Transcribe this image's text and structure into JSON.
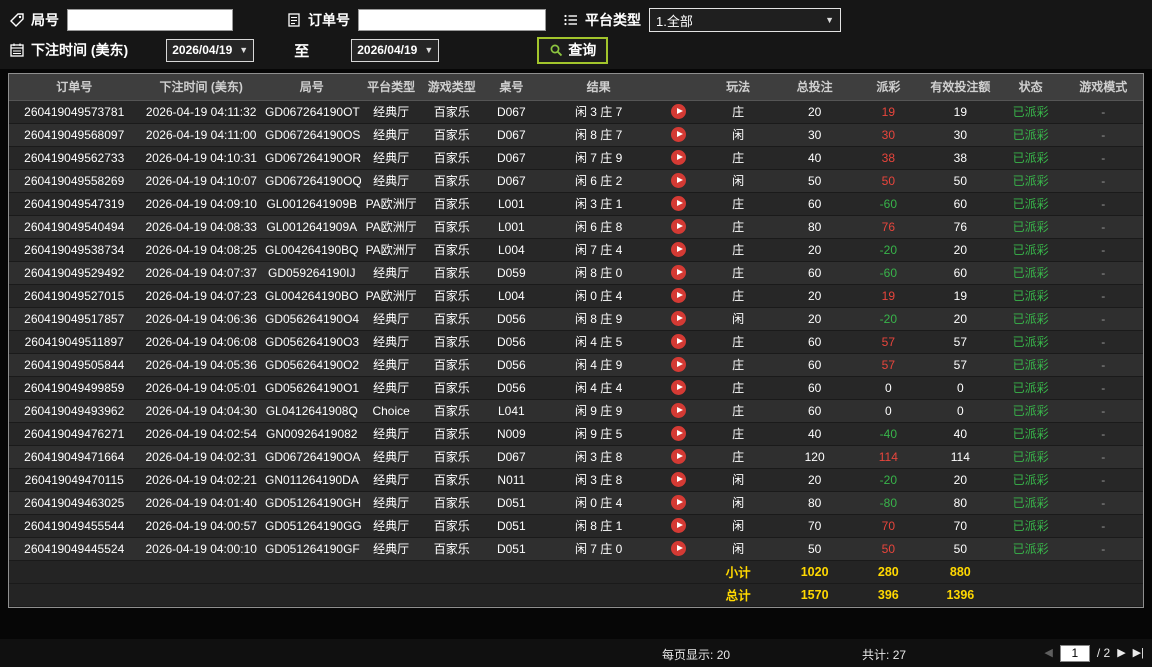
{
  "filters": {
    "round_label": "局号",
    "round_value": "",
    "order_label": "订单号",
    "order_value": "",
    "platform_label": "平台类型",
    "platform_value": "1.全部",
    "bet_time_label": "下注时间 (美东)",
    "date_from": "2026/04/19",
    "to_label": "至",
    "date_to": "2026/04/19",
    "search_label": "查询"
  },
  "icons": {
    "round": "tag-icon",
    "order": "clipboard-icon",
    "platform": "list-icon",
    "bet_time": "calendar-icon",
    "search": "magnifier-icon",
    "video": "play-icon",
    "dropdown_arrow": "▼"
  },
  "table": {
    "headers": [
      "订单号",
      "下注时间 (美东)",
      "局号",
      "平台类型",
      "游戏类型",
      "桌号",
      "结果",
      "",
      "玩法",
      "总投注",
      "派彩",
      "有效投注额",
      "状态",
      "游戏模式"
    ],
    "rows": [
      {
        "order_id": "260419049573781",
        "bet_time": "2026-04-19 04:11:32",
        "round_id": "GD067264190OT",
        "platform": "经典厅",
        "game_type": "百家乐",
        "table_no": "D067",
        "result": "闲 3 庄 7",
        "play": "庄",
        "total_bet": 20,
        "payout": 19,
        "valid_bet": 19,
        "status": "已派彩",
        "mode": "-"
      },
      {
        "order_id": "260419049568097",
        "bet_time": "2026-04-19 04:11:00",
        "round_id": "GD067264190OS",
        "platform": "经典厅",
        "game_type": "百家乐",
        "table_no": "D067",
        "result": "闲 8 庄 7",
        "play": "闲",
        "total_bet": 30,
        "payout": 30,
        "valid_bet": 30,
        "status": "已派彩",
        "mode": "-"
      },
      {
        "order_id": "260419049562733",
        "bet_time": "2026-04-19 04:10:31",
        "round_id": "GD067264190OR",
        "platform": "经典厅",
        "game_type": "百家乐",
        "table_no": "D067",
        "result": "闲 7 庄 9",
        "play": "庄",
        "total_bet": 40,
        "payout": 38,
        "valid_bet": 38,
        "status": "已派彩",
        "mode": "-"
      },
      {
        "order_id": "260419049558269",
        "bet_time": "2026-04-19 04:10:07",
        "round_id": "GD067264190OQ",
        "platform": "经典厅",
        "game_type": "百家乐",
        "table_no": "D067",
        "result": "闲 6 庄 2",
        "play": "闲",
        "total_bet": 50,
        "payout": 50,
        "valid_bet": 50,
        "status": "已派彩",
        "mode": "-"
      },
      {
        "order_id": "260419049547319",
        "bet_time": "2026-04-19 04:09:10",
        "round_id": "GL0012641909B",
        "platform": "PA欧洲厅",
        "game_type": "百家乐",
        "table_no": "L001",
        "result": "闲 3 庄 1",
        "play": "庄",
        "total_bet": 60,
        "payout": -60,
        "valid_bet": 60,
        "status": "已派彩",
        "mode": "-"
      },
      {
        "order_id": "260419049540494",
        "bet_time": "2026-04-19 04:08:33",
        "round_id": "GL0012641909A",
        "platform": "PA欧洲厅",
        "game_type": "百家乐",
        "table_no": "L001",
        "result": "闲 6 庄 8",
        "play": "庄",
        "total_bet": 80,
        "payout": 76,
        "valid_bet": 76,
        "status": "已派彩",
        "mode": "-"
      },
      {
        "order_id": "260419049538734",
        "bet_time": "2026-04-19 04:08:25",
        "round_id": "GL004264190BQ",
        "platform": "PA欧洲厅",
        "game_type": "百家乐",
        "table_no": "L004",
        "result": "闲 7 庄 4",
        "play": "庄",
        "total_bet": 20,
        "payout": -20,
        "valid_bet": 20,
        "status": "已派彩",
        "mode": "-"
      },
      {
        "order_id": "260419049529492",
        "bet_time": "2026-04-19 04:07:37",
        "round_id": "GD059264190IJ",
        "platform": "经典厅",
        "game_type": "百家乐",
        "table_no": "D059",
        "result": "闲 8 庄 0",
        "play": "庄",
        "total_bet": 60,
        "payout": -60,
        "valid_bet": 60,
        "status": "已派彩",
        "mode": "-"
      },
      {
        "order_id": "260419049527015",
        "bet_time": "2026-04-19 04:07:23",
        "round_id": "GL004264190BO",
        "platform": "PA欧洲厅",
        "game_type": "百家乐",
        "table_no": "L004",
        "result": "闲 0 庄 4",
        "play": "庄",
        "total_bet": 20,
        "payout": 19,
        "valid_bet": 19,
        "status": "已派彩",
        "mode": "-"
      },
      {
        "order_id": "260419049517857",
        "bet_time": "2026-04-19 04:06:36",
        "round_id": "GD056264190O4",
        "platform": "经典厅",
        "game_type": "百家乐",
        "table_no": "D056",
        "result": "闲 8 庄 9",
        "play": "闲",
        "total_bet": 20,
        "payout": -20,
        "valid_bet": 20,
        "status": "已派彩",
        "mode": "-"
      },
      {
        "order_id": "260419049511897",
        "bet_time": "2026-04-19 04:06:08",
        "round_id": "GD056264190O3",
        "platform": "经典厅",
        "game_type": "百家乐",
        "table_no": "D056",
        "result": "闲 4 庄 5",
        "play": "庄",
        "total_bet": 60,
        "payout": 57,
        "valid_bet": 57,
        "status": "已派彩",
        "mode": "-"
      },
      {
        "order_id": "260419049505844",
        "bet_time": "2026-04-19 04:05:36",
        "round_id": "GD056264190O2",
        "platform": "经典厅",
        "game_type": "百家乐",
        "table_no": "D056",
        "result": "闲 4 庄 9",
        "play": "庄",
        "total_bet": 60,
        "payout": 57,
        "valid_bet": 57,
        "status": "已派彩",
        "mode": "-"
      },
      {
        "order_id": "260419049499859",
        "bet_time": "2026-04-19 04:05:01",
        "round_id": "GD056264190O1",
        "platform": "经典厅",
        "game_type": "百家乐",
        "table_no": "D056",
        "result": "闲 4 庄 4",
        "play": "庄",
        "total_bet": 60,
        "payout": 0,
        "valid_bet": 0,
        "status": "已派彩",
        "mode": "-"
      },
      {
        "order_id": "260419049493962",
        "bet_time": "2026-04-19 04:04:30",
        "round_id": "GL0412641908Q",
        "platform": "Choice",
        "game_type": "百家乐",
        "table_no": "L041",
        "result": "闲 9 庄 9",
        "play": "庄",
        "total_bet": 60,
        "payout": 0,
        "valid_bet": 0,
        "status": "已派彩",
        "mode": "-"
      },
      {
        "order_id": "260419049476271",
        "bet_time": "2026-04-19 04:02:54",
        "round_id": "GN00926419082",
        "platform": "经典厅",
        "game_type": "百家乐",
        "table_no": "N009",
        "result": "闲 9 庄 5",
        "play": "庄",
        "total_bet": 40,
        "payout": -40,
        "valid_bet": 40,
        "status": "已派彩",
        "mode": "-"
      },
      {
        "order_id": "260419049471664",
        "bet_time": "2026-04-19 04:02:31",
        "round_id": "GD067264190OA",
        "platform": "经典厅",
        "game_type": "百家乐",
        "table_no": "D067",
        "result": "闲 3 庄 8",
        "play": "庄",
        "total_bet": 120,
        "payout": 114,
        "valid_bet": 114,
        "status": "已派彩",
        "mode": "-"
      },
      {
        "order_id": "260419049470115",
        "bet_time": "2026-04-19 04:02:21",
        "round_id": "GN011264190DA",
        "platform": "经典厅",
        "game_type": "百家乐",
        "table_no": "N011",
        "result": "闲 3 庄 8",
        "play": "闲",
        "total_bet": 20,
        "payout": -20,
        "valid_bet": 20,
        "status": "已派彩",
        "mode": "-"
      },
      {
        "order_id": "260419049463025",
        "bet_time": "2026-04-19 04:01:40",
        "round_id": "GD051264190GH",
        "platform": "经典厅",
        "game_type": "百家乐",
        "table_no": "D051",
        "result": "闲 0 庄 4",
        "play": "闲",
        "total_bet": 80,
        "payout": -80,
        "valid_bet": 80,
        "status": "已派彩",
        "mode": "-"
      },
      {
        "order_id": "260419049455544",
        "bet_time": "2026-04-19 04:00:57",
        "round_id": "GD051264190GG",
        "platform": "经典厅",
        "game_type": "百家乐",
        "table_no": "D051",
        "result": "闲 8 庄 1",
        "play": "闲",
        "total_bet": 70,
        "payout": 70,
        "valid_bet": 70,
        "status": "已派彩",
        "mode": "-"
      },
      {
        "order_id": "260419049445524",
        "bet_time": "2026-04-19 04:00:10",
        "round_id": "GD051264190GF",
        "platform": "经典厅",
        "game_type": "百家乐",
        "table_no": "D051",
        "result": "闲 7 庄 0",
        "play": "闲",
        "total_bet": 50,
        "payout": 50,
        "valid_bet": 50,
        "status": "已派彩",
        "mode": "-"
      }
    ],
    "subtotal": {
      "label": "小计",
      "total_bet": 1020,
      "payout": 280,
      "valid_bet": 880
    },
    "total": {
      "label": "总计",
      "total_bet": 1570,
      "payout": 396,
      "valid_bet": 1396
    }
  },
  "footer": {
    "per_page_label": "每页显示:",
    "per_page": "20",
    "total_label": "共计:",
    "total_count": "27",
    "prev_icon": "◀",
    "page": "1",
    "page_total": "/ 2",
    "next_icon": "▶",
    "last_icon": "▶|"
  },
  "colors": {
    "payout_positive": "#e8453c",
    "payout_negative": "#38b44a",
    "status_paid": "#38b44a",
    "summary_text": "#ffd800",
    "search_border": "#a2c52c",
    "play_button": "#d43a34"
  }
}
